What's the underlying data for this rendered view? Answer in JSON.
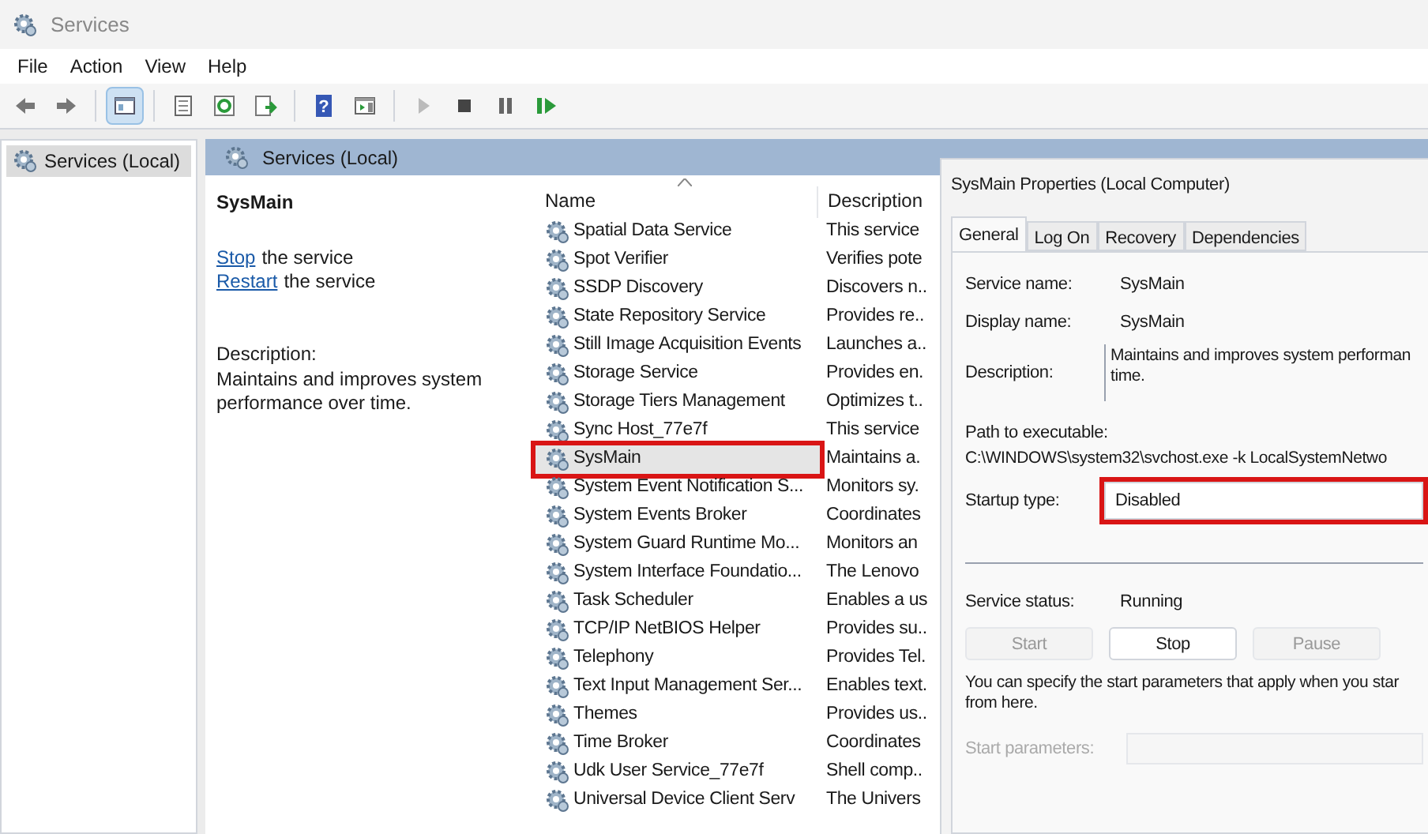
{
  "window": {
    "title": "Services"
  },
  "menu": [
    "File",
    "Action",
    "View",
    "Help"
  ],
  "toolbar": [
    {
      "kind": "back",
      "selected": false,
      "disabled": false
    },
    {
      "kind": "forward",
      "selected": false,
      "disabled": false
    },
    {
      "kind": "sep"
    },
    {
      "kind": "tree",
      "selected": true,
      "disabled": false
    },
    {
      "kind": "sep"
    },
    {
      "kind": "properties",
      "selected": false,
      "disabled": false
    },
    {
      "kind": "refresh",
      "selected": false,
      "disabled": false
    },
    {
      "kind": "export",
      "selected": false,
      "disabled": false
    },
    {
      "kind": "sep"
    },
    {
      "kind": "help",
      "selected": false,
      "disabled": false,
      "label": "?"
    },
    {
      "kind": "actionpane",
      "selected": false,
      "disabled": false
    },
    {
      "kind": "sep"
    },
    {
      "kind": "start",
      "selected": false,
      "disabled": true
    },
    {
      "kind": "stop",
      "selected": false,
      "disabled": false
    },
    {
      "kind": "pause",
      "selected": false,
      "disabled": false
    },
    {
      "kind": "resume",
      "selected": false,
      "disabled": false
    }
  ],
  "tree": [
    {
      "label": "Services (Local)",
      "selected": true
    }
  ],
  "pane_header": "Services (Local)",
  "detail": {
    "title": "SysMain",
    "actions": [
      {
        "link": "Stop",
        "text": "the service"
      },
      {
        "link": "Restart",
        "text": "the service"
      }
    ],
    "description_label": "Description:",
    "description": "Maintains and improves system performance over time."
  },
  "table": {
    "columns": [
      "Name",
      "Description"
    ],
    "rows": [
      {
        "name": "Spatial Data Service",
        "description": "This service",
        "selected": false,
        "highlighted": false
      },
      {
        "name": "Spot Verifier",
        "description": "Verifies pote",
        "selected": false,
        "highlighted": false
      },
      {
        "name": "SSDP Discovery",
        "description": "Discovers n..",
        "selected": false,
        "highlighted": false
      },
      {
        "name": "State Repository Service",
        "description": "Provides re..",
        "selected": false,
        "highlighted": false
      },
      {
        "name": "Still Image Acquisition Events",
        "description": "Launches a..",
        "selected": false,
        "highlighted": false
      },
      {
        "name": "Storage Service",
        "description": "Provides en.",
        "selected": false,
        "highlighted": false
      },
      {
        "name": "Storage Tiers Management",
        "description": "Optimizes t..",
        "selected": false,
        "highlighted": false
      },
      {
        "name": "Sync Host_77e7f",
        "description": "This service",
        "selected": false,
        "highlighted": false
      },
      {
        "name": "SysMain",
        "description": "Maintains a.",
        "selected": true,
        "highlighted": true
      },
      {
        "name": "System Event Notification S...",
        "description": "Monitors sy.",
        "selected": false,
        "highlighted": false
      },
      {
        "name": "System Events Broker",
        "description": "Coordinates",
        "selected": false,
        "highlighted": false
      },
      {
        "name": "System Guard Runtime Mo...",
        "description": "Monitors an",
        "selected": false,
        "highlighted": false
      },
      {
        "name": "System Interface Foundatio...",
        "description": "The Lenovo",
        "selected": false,
        "highlighted": false
      },
      {
        "name": "Task Scheduler",
        "description": "Enables a us",
        "selected": false,
        "highlighted": false
      },
      {
        "name": "TCP/IP NetBIOS Helper",
        "description": "Provides su..",
        "selected": false,
        "highlighted": false
      },
      {
        "name": "Telephony",
        "description": "Provides Tel.",
        "selected": false,
        "highlighted": false
      },
      {
        "name": "Text Input Management Ser...",
        "description": "Enables text.",
        "selected": false,
        "highlighted": false
      },
      {
        "name": "Themes",
        "description": "Provides us..",
        "selected": false,
        "highlighted": false
      },
      {
        "name": "Time Broker",
        "description": "Coordinates",
        "selected": false,
        "highlighted": false
      },
      {
        "name": "Udk User Service_77e7f",
        "description": "Shell comp..",
        "selected": false,
        "highlighted": false
      },
      {
        "name": "Universal Device Client Serv",
        "description": "The Univers",
        "selected": false,
        "highlighted": false
      }
    ]
  },
  "dialog": {
    "title": "SysMain Properties (Local Computer)",
    "tabs": [
      {
        "label": "General",
        "selected": true
      },
      {
        "label": "Log On",
        "selected": false
      },
      {
        "label": "Recovery",
        "selected": false
      },
      {
        "label": "Dependencies",
        "selected": false
      }
    ],
    "service_name": {
      "label": "Service name:",
      "value": "SysMain"
    },
    "display_name": {
      "label": "Display name:",
      "value": "SysMain"
    },
    "description": {
      "label": "Description:",
      "value": "Maintains and improves system performan\ntime."
    },
    "path": {
      "label": "Path to executable:",
      "value": "C:\\WINDOWS\\system32\\svchost.exe -k LocalSystemNetwo"
    },
    "startup_type": {
      "label": "Startup type:",
      "value": "Disabled",
      "highlighted": true
    },
    "service_status": {
      "label": "Service status:",
      "value": "Running"
    },
    "buttons": [
      {
        "label": "Start",
        "disabled": true
      },
      {
        "label": "Stop",
        "disabled": false
      },
      {
        "label": "Pause",
        "disabled": true
      }
    ],
    "hint": "You can specify the start parameters that apply when you star\nfrom here.",
    "start_parameters": {
      "label": "Start parameters:",
      "disabled": true
    }
  }
}
